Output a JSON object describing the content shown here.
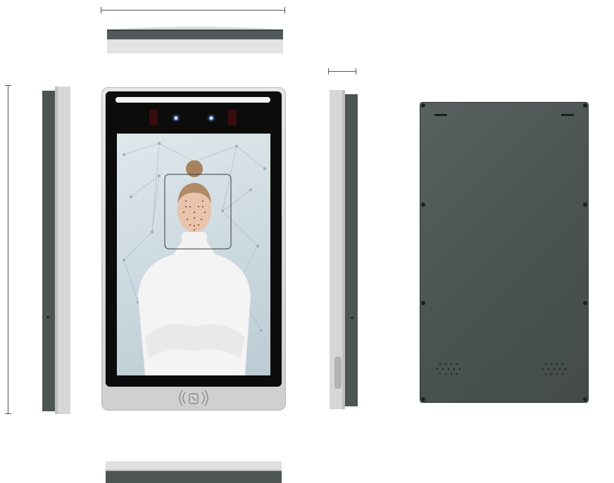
{
  "product": {
    "views": [
      "top",
      "front",
      "left-side",
      "right-side",
      "back",
      "bottom"
    ],
    "nfc_symbol": "nfc-icon",
    "colors": {
      "back_panel": "#4c5453",
      "frame_silver": "#d4d4d4",
      "bezel_black": "#0c0c0c",
      "ir_led": "#3a0d0d"
    }
  }
}
